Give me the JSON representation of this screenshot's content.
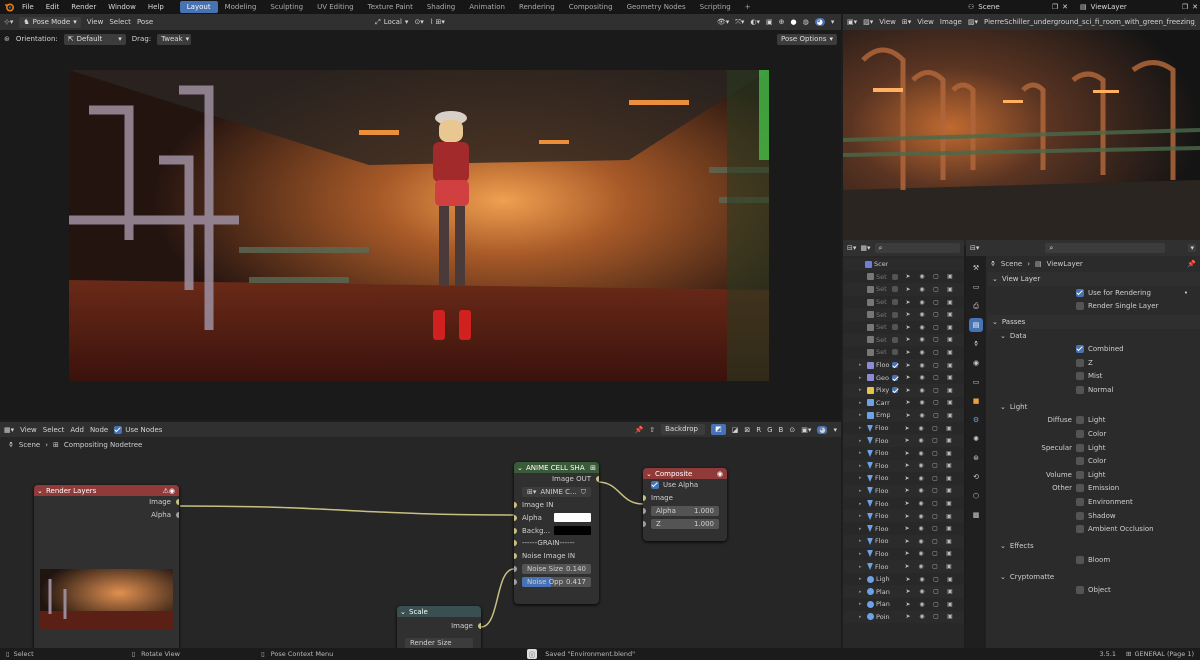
{
  "topbar": {
    "menus": [
      "File",
      "Edit",
      "Render",
      "Window",
      "Help"
    ],
    "workspaces": [
      "Layout",
      "Modeling",
      "Sculpting",
      "UV Editing",
      "Texture Paint",
      "Shading",
      "Animation",
      "Rendering",
      "Compositing",
      "Geometry Nodes",
      "Scripting"
    ],
    "active_workspace": "Layout",
    "scene": "Scene",
    "view_layer": "ViewLayer"
  },
  "viewport": {
    "mode": "Pose Mode",
    "menus": [
      "View",
      "Select",
      "Pose"
    ],
    "transform_orientation": "Local",
    "orientation_label": "Orientation:",
    "orientation_value": "Default",
    "drag_label": "Drag:",
    "drag_value": "Tweak",
    "pose_options": "Pose Options"
  },
  "image_viewer": {
    "menus": [
      "View",
      "View",
      "Image"
    ],
    "image_name": "PierreSchiller_underground_sci_fi_room_with_green_freezing_liqu"
  },
  "outliner": {
    "rows": [
      {
        "name": "Scene C",
        "dim": false,
        "icon": "scene-icon",
        "color": "#6f7fd9",
        "check": false,
        "level": 0
      },
      {
        "name": "Set",
        "dim": true,
        "icon": "collection-icon",
        "color": "#777",
        "check": false
      },
      {
        "name": "Set",
        "dim": true,
        "icon": "collection-icon",
        "color": "#777",
        "check": false
      },
      {
        "name": "Set",
        "dim": true,
        "icon": "collection-icon",
        "color": "#777",
        "check": false
      },
      {
        "name": "Set",
        "dim": true,
        "icon": "collection-icon",
        "color": "#777",
        "check": false
      },
      {
        "name": "Set",
        "dim": true,
        "icon": "collection-icon",
        "color": "#777",
        "check": false
      },
      {
        "name": "Set",
        "dim": true,
        "icon": "collection-icon",
        "color": "#777",
        "check": false
      },
      {
        "name": "Set",
        "dim": true,
        "icon": "collection-icon",
        "color": "#777",
        "check": false
      },
      {
        "name": "Floo",
        "dim": false,
        "icon": "collection-icon",
        "color": "#8b8bd8",
        "check": true
      },
      {
        "name": "Geo",
        "dim": false,
        "icon": "collection-icon",
        "color": "#8b8bd8",
        "check": true
      },
      {
        "name": "Pixy",
        "dim": false,
        "icon": "collection-icon",
        "color": "#e2c54a",
        "check": true
      },
      {
        "name": "Carr",
        "dim": false,
        "icon": "armature-icon",
        "color": "#6ea2e6",
        "check": false
      },
      {
        "name": "Emp",
        "dim": false,
        "icon": "empty-icon",
        "color": "#6ea2e6",
        "check": false
      },
      {
        "name": "Floo",
        "dim": false,
        "icon": "mesh-icon",
        "color": "#6ea2e6",
        "check": false
      },
      {
        "name": "Floo",
        "dim": false,
        "icon": "mesh-icon",
        "color": "#6ea2e6",
        "check": false
      },
      {
        "name": "Floo",
        "dim": false,
        "icon": "mesh-icon",
        "color": "#6ea2e6",
        "check": false
      },
      {
        "name": "Floo",
        "dim": false,
        "icon": "mesh-icon",
        "color": "#6ea2e6",
        "check": false
      },
      {
        "name": "Floo",
        "dim": false,
        "icon": "mesh-icon",
        "color": "#6ea2e6",
        "check": false
      },
      {
        "name": "Floo",
        "dim": false,
        "icon": "mesh-icon",
        "color": "#6ea2e6",
        "check": false
      },
      {
        "name": "Floo",
        "dim": false,
        "icon": "mesh-icon",
        "color": "#6ea2e6",
        "check": false
      },
      {
        "name": "Floo",
        "dim": false,
        "icon": "mesh-icon",
        "color": "#6ea2e6",
        "check": false
      },
      {
        "name": "Floo",
        "dim": false,
        "icon": "mesh-icon",
        "color": "#6ea2e6",
        "check": false
      },
      {
        "name": "Floo",
        "dim": false,
        "icon": "mesh-icon",
        "color": "#6ea2e6",
        "check": false
      },
      {
        "name": "Floo",
        "dim": false,
        "icon": "mesh-icon",
        "color": "#6ea2e6",
        "check": false
      },
      {
        "name": "Floo",
        "dim": false,
        "icon": "mesh-icon",
        "color": "#6ea2e6",
        "check": false
      },
      {
        "name": "Ligh",
        "dim": false,
        "icon": "light-icon",
        "color": "#6ea2e6",
        "check": false
      },
      {
        "name": "Plan",
        "dim": false,
        "icon": "plane-icon",
        "color": "#6ea2e6",
        "check": false
      },
      {
        "name": "Plan",
        "dim": false,
        "icon": "plane-icon",
        "color": "#6ea2e6",
        "check": false
      },
      {
        "name": "Poin",
        "dim": false,
        "icon": "light-icon",
        "color": "#6ea2e6",
        "check": false
      }
    ]
  },
  "properties": {
    "breadcrumb_scene": "Scene",
    "breadcrumb_layer": "ViewLayer",
    "view_layer_title": "View Layer",
    "use_for_rendering": "Use for Rendering",
    "render_single_layer": "Render Single Layer",
    "passes_title": "Passes",
    "data_title": "Data",
    "data_items": [
      {
        "label": "Combined",
        "on": true
      },
      {
        "label": "Z",
        "on": false
      },
      {
        "label": "Mist",
        "on": false
      },
      {
        "label": "Normal",
        "on": false
      }
    ],
    "light_title": "Light",
    "light_rows": [
      {
        "lbl": "Diffuse",
        "item": "Light"
      },
      {
        "lbl": "",
        "item": "Color"
      },
      {
        "lbl": "Specular",
        "item": "Light"
      },
      {
        "lbl": "",
        "item": "Color"
      },
      {
        "lbl": "Volume",
        "item": "Light"
      },
      {
        "lbl": "Other",
        "item": "Emission"
      },
      {
        "lbl": "",
        "item": "Environment"
      },
      {
        "lbl": "",
        "item": "Shadow"
      },
      {
        "lbl": "",
        "item": "Ambient Occlusion"
      }
    ],
    "effects_title": "Effects",
    "bloom": "Bloom",
    "crypto_title": "Cryptomatte",
    "object": "Object"
  },
  "node_editor": {
    "menus": [
      "View",
      "Select",
      "Add",
      "Node"
    ],
    "use_nodes": "Use Nodes",
    "backdrop": "Backdrop",
    "channels": [
      "R",
      "G",
      "B"
    ],
    "breadcrumb_scene": "Scene",
    "breadcrumb_tree": "Compositing Nodetree",
    "render_layers": {
      "title": "Render Layers",
      "image": "Image",
      "alpha": "Alpha"
    },
    "anime": {
      "title": "ANIME CELL SHA",
      "out": "Image OUT",
      "group": "ANIME C...",
      "image_in": "Image IN",
      "alpha": "Alpha",
      "background": "Backg...",
      "grain": "------GRAIN------",
      "noise_in": "Noise Image IN",
      "noise_size_label": "Noise Size",
      "noise_size": "0.140",
      "noise_opp_label": "Noise Opp",
      "noise_opp": "0.417"
    },
    "composite": {
      "title": "Composite",
      "use_alpha": "Use Alpha",
      "image": "Image",
      "alpha": "Alpha",
      "alpha_val": "1.000",
      "z": "Z",
      "z_val": "1.000"
    },
    "scale": {
      "title": "Scale",
      "image": "Image",
      "render_size": "Render Size"
    }
  },
  "status": {
    "select": "Select",
    "rotate": "Rotate View",
    "context": "Pose Context Menu",
    "saved": "Saved \"Environment.blend\"",
    "version": "3.5.1",
    "scene_info": "GENERAL (Page 1)"
  }
}
